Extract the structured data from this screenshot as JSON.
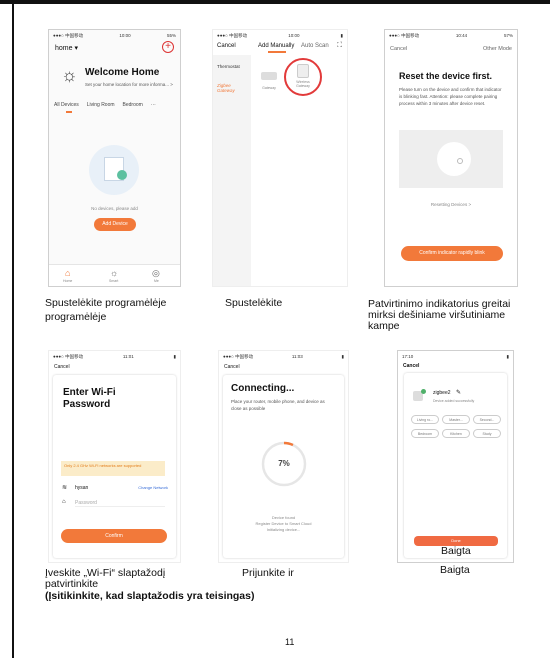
{
  "page_number": "11",
  "screen1": {
    "status_time": "10:00",
    "status_battery": "55%",
    "home_label": "home ▾",
    "welcome_title": "Welcome Home",
    "welcome_sub": "Set your home location for more informa... >",
    "tabs": [
      "All Devices",
      "Living Room",
      "Bedroom",
      "···"
    ],
    "empty_text": "No devices, please add",
    "add_device_label": "Add Device",
    "bottom_tabs": [
      "Home",
      "Smart",
      "Me"
    ]
  },
  "screen2": {
    "status_time": "10:00",
    "cancel_label": "Cancel",
    "tab_manual": "Add Manually",
    "tab_auto": "Auto Scan",
    "side_items": [
      "Thermostat",
      "Zigbee Gateway"
    ],
    "device_labels": [
      "Gateway",
      "Wireless Gateway"
    ]
  },
  "screen3": {
    "status_time": "10:44",
    "status_battery": "57%",
    "cancel_label": "Cancel",
    "other_mode_label": "Other Mode",
    "title": "Reset the device first.",
    "body": "Please turn on the device and confirm that indicator is blinking fast. Attention: please complete pairing process within 3 minutes after device reset.",
    "resetting_link": "Resetting Devices >",
    "confirm_label": "Confirm indicator rapidly blink"
  },
  "screen4": {
    "status_time": "11:01",
    "cancel_label": "Cancel",
    "title": "Enter Wi-Fi Password",
    "notice": "Only 2.4 GHz Wi-Fi networks are supported",
    "wifi_name": "hysan",
    "change_network": "Change Network",
    "password_placeholder": "Password",
    "confirm_label": "Confirm"
  },
  "screen5": {
    "status_time": "11:03",
    "cancel_label": "Cancel",
    "title": "Connecting...",
    "sub": "Place your router, mobile phone, and device as close as possible",
    "progress_text": "7%",
    "progress_fraction": 0.07,
    "step1": "Device found",
    "step2": "Register Device to Smart Cloud",
    "step3": "Initializing device..."
  },
  "screen6": {
    "status_time": "17:10",
    "cancel_label": "Cancel",
    "device_name": "zigbee2",
    "device_added": "Device added successfully",
    "rooms": [
      "Living ro...",
      "Master...",
      "Second...",
      "Bedroom",
      "Kitchen",
      "Study"
    ],
    "done_label": "Done",
    "done_overlay": "Baigta"
  },
  "captions": {
    "c1_line1": "Spustelėkite programėlėje",
    "c1_line2": "programėlėje",
    "c2": "Spustelėkite",
    "c3_line1": "Patvirtinimo indikatorius greitai",
    "c3_line2": "mirksi dešiniame viršutiniame",
    "c3_line3": "kampe",
    "c4_line1": "Įveskite „Wi-Fi“ slaptažodį",
    "c4_line2": "patvirtinkite",
    "c5": "Prijunkite ir",
    "c6": "Baigta",
    "note": "(Įsitikinkite, kad slaptažodis yra teisingas)"
  },
  "colors": {
    "accent": "#f2793a",
    "ring": "#e23a3a"
  }
}
